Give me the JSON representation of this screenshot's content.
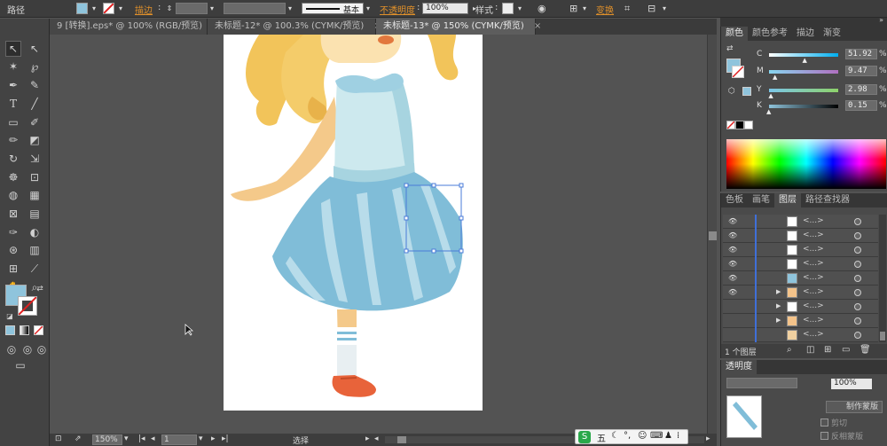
{
  "topbar": {
    "object_label": "路径",
    "stroke_label": "描边",
    "basic_label": "基本",
    "opacity_label": "不透明度",
    "opacity_value": "100%",
    "style_label": "样式",
    "transform_label": "变换",
    "fill_color": "#8fc4dc"
  },
  "tabs": [
    {
      "label": "9 [转换].eps* @ 100% (RGB/预览)",
      "close": "×"
    },
    {
      "label": "未标题-12* @ 100.3% (CYMK/预览)",
      "close": "×"
    },
    {
      "label": "未标题-13* @ 150% (CYMK/预览)",
      "close": "×"
    }
  ],
  "status": {
    "zoom": "150%",
    "page": "1",
    "tool": "选择"
  },
  "color_panel": {
    "tabs": [
      "颜色",
      "颜色参考",
      "描边",
      "渐变"
    ],
    "channels": [
      {
        "label": "C",
        "value": "51.92",
        "pct": 0.52,
        "grad": "linear-gradient(to right,#ffffff,#00aeef)"
      },
      {
        "label": "M",
        "value": "9.47",
        "pct": 0.09,
        "grad": "linear-gradient(to right,#88d6f0,#b070c0)"
      },
      {
        "label": "Y",
        "value": "2.98",
        "pct": 0.03,
        "grad": "linear-gradient(to right,#7bc6e8,#8ed26a)"
      },
      {
        "label": "K",
        "value": "0.15",
        "pct": 0.0,
        "grad": "linear-gradient(to right,#8fc4dc,#000000)"
      }
    ],
    "pct_sign": "%"
  },
  "layers_panel": {
    "tabs": [
      "色板",
      "画笔",
      "图层",
      "路径查找器"
    ],
    "footer": "1 个图层",
    "rows": [
      {
        "thumb": "#ffffff",
        "expand": ""
      },
      {
        "thumb": "#ffffff",
        "expand": ""
      },
      {
        "thumb": "#ffffff",
        "expand": ""
      },
      {
        "thumb": "#ffffff",
        "expand": ""
      },
      {
        "thumb": "#8fc4dc",
        "expand": ""
      },
      {
        "thumb": "#f4c38a",
        "expand": "▶"
      },
      {
        "thumb": "#ffffff",
        "expand": "▶"
      },
      {
        "thumb": "#f4c38a",
        "expand": "▶"
      },
      {
        "thumb": "#f0d0a0",
        "expand": ""
      }
    ],
    "row_label": "<...>"
  },
  "bottom_panel": {
    "tab": "透明度",
    "opacity_value": "100%",
    "make_mask": "制作蒙版",
    "clip": "剪切",
    "invert_mask": "反相蒙版"
  },
  "ime": {
    "label": "五"
  }
}
